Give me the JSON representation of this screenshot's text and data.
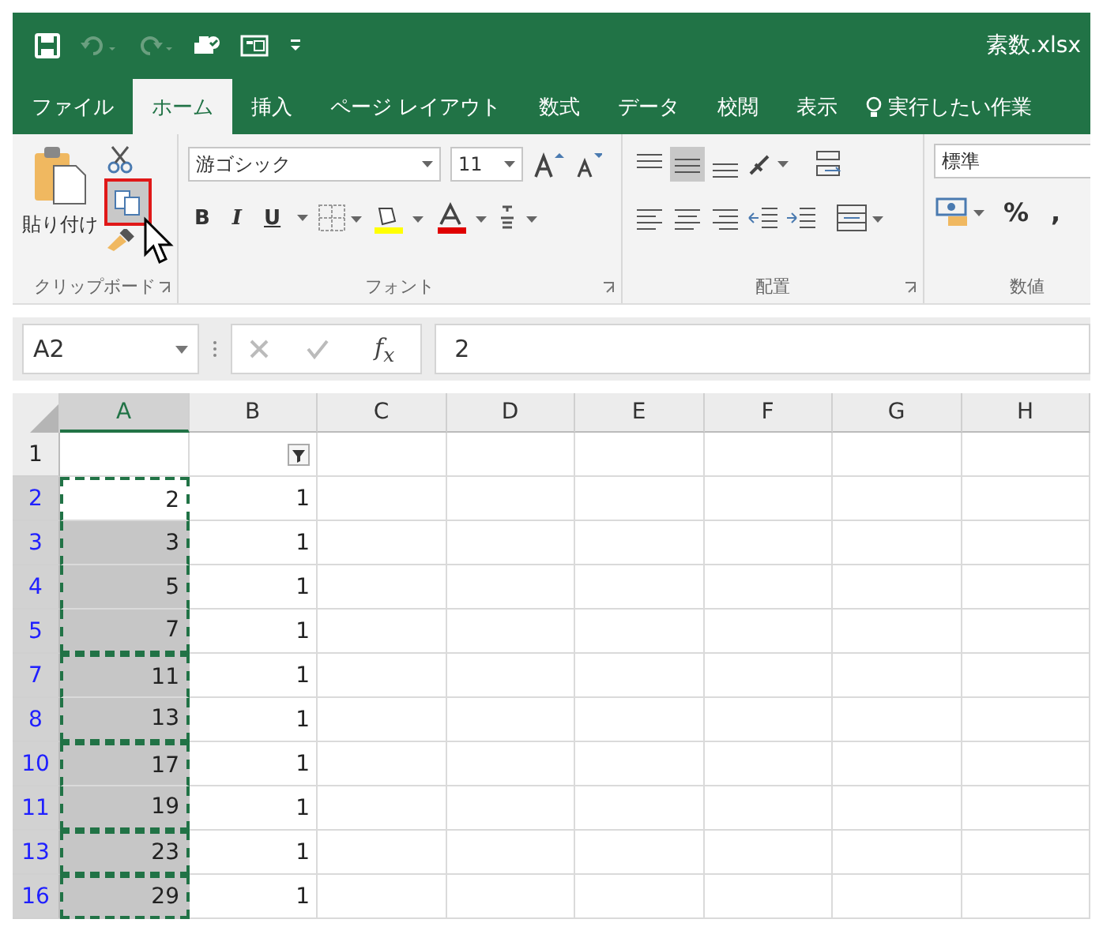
{
  "window": {
    "title": "素数.xlsx"
  },
  "tabs": [
    {
      "label": "ファイル",
      "selected": false
    },
    {
      "label": "ホーム",
      "selected": true
    },
    {
      "label": "挿入",
      "selected": false
    },
    {
      "label": "ページ レイアウト",
      "selected": false
    },
    {
      "label": "数式",
      "selected": false
    },
    {
      "label": "データ",
      "selected": false
    },
    {
      "label": "校閲",
      "selected": false
    },
    {
      "label": "表示",
      "selected": false
    }
  ],
  "tell_me": {
    "placeholder": "実行したい作業"
  },
  "ribbon": {
    "clipboard": {
      "label": "クリップボード",
      "paste": "貼り付け",
      "copy_highlighted": true
    },
    "font": {
      "label": "フォント",
      "font_name": "游ゴシック",
      "font_size": "11",
      "bold": "B",
      "italic": "I",
      "underline": "U"
    },
    "alignment": {
      "label": "配置"
    },
    "number": {
      "label": "数値",
      "format": "標準",
      "percent": "%",
      "comma": ","
    }
  },
  "formula_bar": {
    "name_box": "A2",
    "function": "f$_{x}$",
    "value": "2"
  },
  "sheet": {
    "columns": [
      {
        "label": "A",
        "selected": true
      },
      {
        "label": "B",
        "selected": false
      },
      {
        "label": "C",
        "selected": false
      },
      {
        "label": "D",
        "selected": false
      },
      {
        "label": "E",
        "selected": false
      },
      {
        "label": "F",
        "selected": false
      },
      {
        "label": "G",
        "selected": false
      },
      {
        "label": "H",
        "selected": false
      }
    ],
    "rows": [
      {
        "header": "1",
        "filtered": false,
        "selected": false,
        "active": false,
        "block_start": false,
        "a": "",
        "b": "",
        "filter_button": true
      },
      {
        "header": "2",
        "filtered": true,
        "selected": true,
        "active": true,
        "block_start": true,
        "a": "2",
        "b": "1"
      },
      {
        "header": "3",
        "filtered": true,
        "selected": true,
        "active": false,
        "block_start": false,
        "a": "3",
        "b": "1"
      },
      {
        "header": "4",
        "filtered": true,
        "selected": true,
        "active": false,
        "block_start": false,
        "a": "5",
        "b": "1"
      },
      {
        "header": "5",
        "filtered": true,
        "selected": true,
        "active": false,
        "block_start": false,
        "a": "7",
        "b": "1"
      },
      {
        "header": "7",
        "filtered": true,
        "selected": true,
        "active": false,
        "block_start": true,
        "a": "11",
        "b": "1"
      },
      {
        "header": "8",
        "filtered": true,
        "selected": true,
        "active": false,
        "block_start": false,
        "a": "13",
        "b": "1"
      },
      {
        "header": "10",
        "filtered": true,
        "selected": true,
        "active": false,
        "block_start": true,
        "a": "17",
        "b": "1"
      },
      {
        "header": "11",
        "filtered": true,
        "selected": true,
        "active": false,
        "block_start": false,
        "a": "19",
        "b": "1"
      },
      {
        "header": "13",
        "filtered": true,
        "selected": true,
        "active": false,
        "block_start": true,
        "a": "23",
        "b": "1"
      },
      {
        "header": "16",
        "filtered": true,
        "selected": true,
        "active": false,
        "block_start": true,
        "a": "29",
        "b": "1"
      }
    ]
  }
}
